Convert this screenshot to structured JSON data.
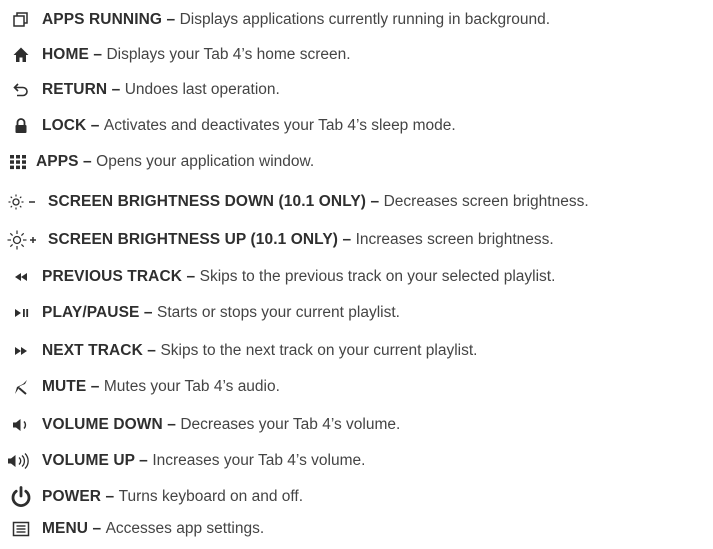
{
  "keys": [
    {
      "icon": "apps-running-icon",
      "name": "APPS RUNNING",
      "sep": " – ",
      "desc": "Displays applications currently running in background."
    },
    {
      "icon": "home-icon",
      "name": "HOME",
      "sep": " – ",
      "desc": "Displays your Tab 4’s home screen."
    },
    {
      "icon": "return-icon",
      "name": "RETURN",
      "sep": " – ",
      "desc": "Undoes last operation."
    },
    {
      "icon": "lock-icon",
      "name": "LOCK",
      "sep": " – ",
      "desc": "Activates and deactivates your Tab 4’s sleep mode."
    },
    {
      "icon": "apps-icon",
      "name": "APPS",
      "sep": " – ",
      "desc": "Opens your application window."
    },
    {
      "icon": "brightness-down-icon",
      "name": "SCREEN BRIGHTNESS DOWN (10.1 ONLY)",
      "sep": " – ",
      "desc": "Decreases screen brightness."
    },
    {
      "icon": "brightness-up-icon",
      "name": "SCREEN BRIGHTNESS UP (10.1 ONLY)",
      "sep": " – ",
      "desc": "Increases screen brightness."
    },
    {
      "icon": "previous-track-icon",
      "name": "PREVIOUS TRACK",
      "sep": " – ",
      "desc": "Skips to the previous track on your selected playlist."
    },
    {
      "icon": "play-pause-icon",
      "name": "PLAY/PAUSE",
      "sep": " – ",
      "desc": "Starts or stops your current playlist."
    },
    {
      "icon": "next-track-icon",
      "name": "NEXT TRACK",
      "sep": " – ",
      "desc": "Skips to the next track on your current playlist."
    },
    {
      "icon": "mute-icon",
      "name": "MUTE",
      "sep": " – ",
      "desc": "Mutes your Tab 4’s audio."
    },
    {
      "icon": "volume-down-icon",
      "name": "VOLUME DOWN",
      "sep": " – ",
      "desc": "Decreases your Tab 4’s volume."
    },
    {
      "icon": "volume-up-icon",
      "name": "VOLUME UP",
      "sep": " – ",
      "desc": "Increases your Tab 4’s volume."
    },
    {
      "icon": "power-icon",
      "name": "POWER",
      "sep": " – ",
      "desc": "Turns keyboard on and off."
    },
    {
      "icon": "menu-icon",
      "name": "MENU",
      "sep": " – ",
      "desc": "Accesses app settings."
    }
  ]
}
